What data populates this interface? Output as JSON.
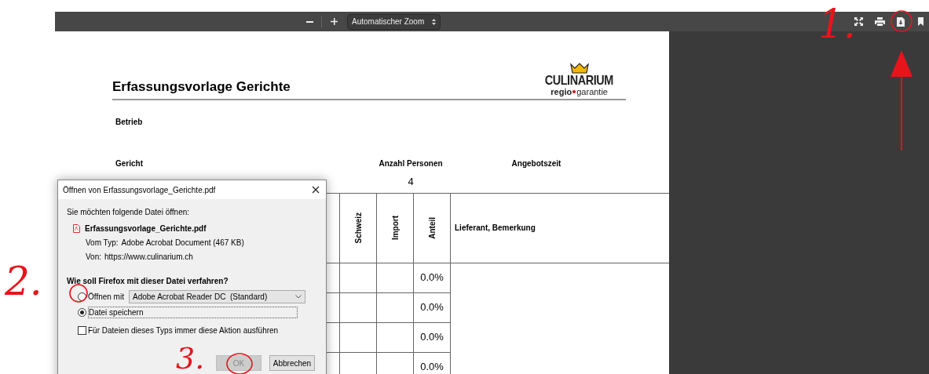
{
  "toolbar": {
    "zoom_select": "Automatischer Zoom"
  },
  "document": {
    "logo": {
      "name": "CULINARIUM",
      "tagline_bold": "regio",
      "tagline": "garantie"
    },
    "title": "Erfassungsvorlage Gerichte",
    "fields": [
      {
        "label": "Betrieb"
      }
    ],
    "header_labels": [
      {
        "label": "Gericht"
      },
      {
        "label": "Anzahl Personen",
        "value": "4"
      },
      {
        "label": "Angebotszeit"
      }
    ],
    "table": {
      "columns": [
        "Schweiz",
        "Import",
        "Anteil",
        "Lieferant, Bemerkung"
      ],
      "rows": [
        {
          "anteil": "0.0%"
        },
        {
          "anteil": "0.0%"
        },
        {
          "anteil": "0.0%"
        },
        {
          "anteil": "0.0%"
        }
      ]
    }
  },
  "dialog": {
    "title": "Öffnen von Erfassungsvorlage_Gerichte.pdf",
    "intro": "Sie möchten folgende Datei öffnen:",
    "file_name": "Erfassungsvorlage_Gerichte.pdf",
    "details": [
      {
        "label": "Vom Typ:",
        "value": "Adobe Acrobat Document (467 KB)"
      },
      {
        "label": "Von:",
        "value": "https://www.culinarium.ch"
      }
    ],
    "question": "Wie soll Firefox mit dieser Datei verfahren?",
    "options": [
      {
        "label": "Öffnen mit",
        "selected": false,
        "app": "Adobe Acrobat Reader DC  (Standard)"
      },
      {
        "label": "Datei speichern",
        "selected": true
      }
    ],
    "always_checkbox": {
      "label": "Für Dateien dieses Typs immer diese Aktion ausführen",
      "checked": false
    },
    "buttons": [
      {
        "label": "OK",
        "disabled": true
      },
      {
        "label": "Abbrechen",
        "disabled": false
      }
    ]
  },
  "annotations": [
    "1.",
    "2.",
    "3."
  ]
}
